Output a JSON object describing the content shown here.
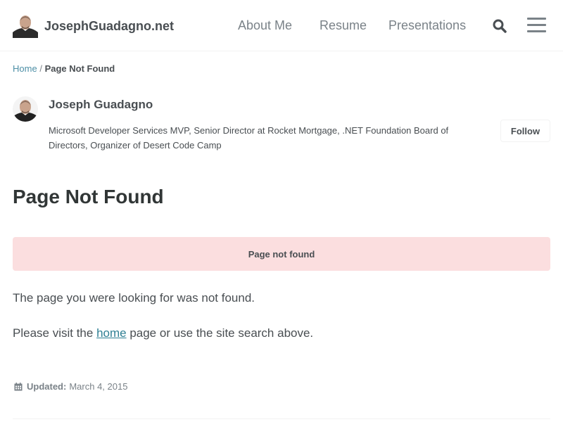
{
  "site": {
    "title": "JosephGuadagno.net"
  },
  "nav": {
    "items": [
      {
        "label": "About Me"
      },
      {
        "label": "Resume"
      },
      {
        "label": "Presentations"
      }
    ],
    "search_icon": "search-icon",
    "menu_icon": "hamburger-menu-icon"
  },
  "breadcrumbs": {
    "home": "Home",
    "separator": "/",
    "current": "Page Not Found"
  },
  "author": {
    "name": "Joseph Guadagno",
    "bio": "Microsoft Developer Services MVP, Senior Director at Rocket Mortgage, .NET Foundation Board of Directors, Organizer of Desert Code Camp",
    "follow_label": "Follow"
  },
  "page": {
    "title": "Page Not Found",
    "notice": "Page not found",
    "paragraph1": "The page you were looking for was not found.",
    "paragraph2_before": "Please visit the ",
    "paragraph2_link": "home",
    "paragraph2_after": " page or use the site search above."
  },
  "meta": {
    "updated_label": "Updated:",
    "updated_date": "March 4, 2015"
  },
  "colors": {
    "notice_bg": "#fbdedf",
    "link": "#4d8fa6",
    "text": "#494e52"
  }
}
